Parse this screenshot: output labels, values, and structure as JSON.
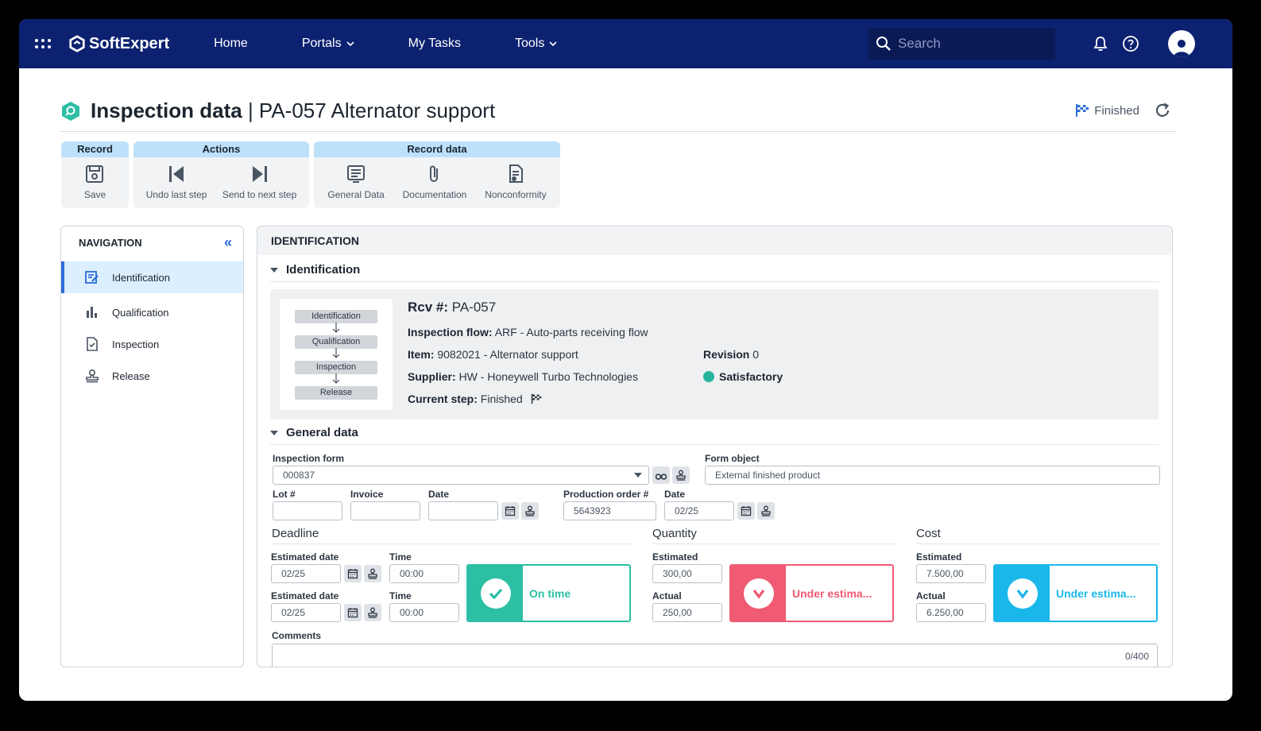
{
  "topbar": {
    "brand": "SoftExpert",
    "nav": [
      {
        "label": "Home"
      },
      {
        "label": "Portals"
      },
      {
        "label": "My Tasks"
      },
      {
        "label": "Tools"
      }
    ],
    "search_placeholder": "Search",
    "icons": [
      "apps-grid-icon",
      "bell-icon",
      "help-icon",
      "avatar-icon"
    ]
  },
  "header": {
    "title_bold": "Inspection data",
    "title_rest": "| PA-057 Alternator support",
    "status": "Finished"
  },
  "ribbon": {
    "groups": [
      {
        "title": "Record",
        "buttons": [
          {
            "label": "Save"
          }
        ]
      },
      {
        "title": "Actions",
        "buttons": [
          {
            "label": "Undo last step"
          },
          {
            "label": "Send to next step"
          }
        ]
      },
      {
        "title": "Record data",
        "buttons": [
          {
            "label": "General Data"
          },
          {
            "label": "Documentation"
          },
          {
            "label": "Nonconformity"
          }
        ]
      }
    ]
  },
  "navigation": {
    "title": "NAVIGATION",
    "collapse": "«",
    "items": [
      {
        "label": "Identification",
        "active": true
      },
      {
        "label": "Qualification"
      },
      {
        "label": "Inspection"
      },
      {
        "label": "Release"
      }
    ]
  },
  "main": {
    "title": "IDENTIFICATION",
    "identification": {
      "section_title": "Identification",
      "flow_steps": [
        "Identification",
        "Qualification",
        "Inspection",
        "Release"
      ],
      "rcv_label": "Rcv #:",
      "rcv_value": "PA-057",
      "flow_label": "Inspection flow:",
      "flow_value": "ARF - Auto-parts receiving flow",
      "item_label": "Item:",
      "item_value": "9082021 - Alternator support",
      "revision_label": "Revision",
      "revision_value": "0",
      "supplier_label": "Supplier:",
      "supplier_value": "HW - Honeywell Turbo Technologies",
      "rating": "Satisfactory",
      "step_label": "Current step:",
      "step_value": "Finished"
    },
    "general": {
      "section_title": "General data",
      "inspection_form_label": "Inspection form",
      "inspection_form_value": "000837",
      "form_object_label": "Form object",
      "form_object_value": "External finished product",
      "lot_label": "Lot #",
      "lot_value": "",
      "invoice_label": "Invoice",
      "invoice_value": "",
      "date_label": "Date",
      "date_value": "",
      "production_order_label": "Production order #",
      "production_order_value": "5643923",
      "date2_label": "Date",
      "date2_value": "02/25",
      "deadline": {
        "title": "Deadline",
        "est_date_label": "Estimated date",
        "est_date_value": "02/25",
        "time_label": "Time",
        "time_value": "00:00",
        "est_date2_label": "Estimated date",
        "est_date2_value": "02/25",
        "time2_label": "Time",
        "time2_value": "00:00",
        "indicator": "On time",
        "color": "#2cbfa4"
      },
      "quantity": {
        "title": "Quantity",
        "estimated_label": "Estimated",
        "estimated_value": "300,00",
        "actual_label": "Actual",
        "actual_value": "250,00",
        "indicator": "Under estima...",
        "color": "#f05a73"
      },
      "cost": {
        "title": "Cost",
        "estimated_label": "Estimated",
        "estimated_value": "7.500,00",
        "actual_label": "Actual",
        "actual_value": "6.250,00",
        "indicator": "Under estima...",
        "color": "#1ab8ea"
      },
      "comments_label": "Comments",
      "comments_counter": "0/400"
    }
  }
}
